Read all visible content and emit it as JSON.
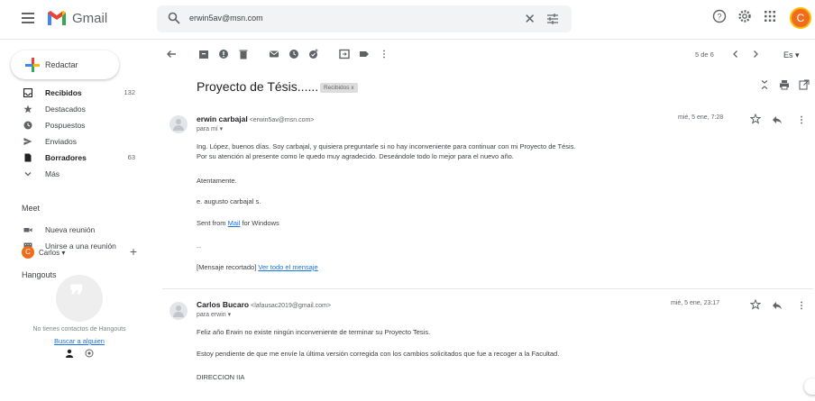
{
  "app": {
    "brand": "Gmail",
    "avatar_letter": "C",
    "colors": {
      "avatar": "#f06c1c",
      "link": "#1a73e8",
      "gmail_red": "#ea4335",
      "gmail_blue": "#4285f4",
      "gmail_green": "#34a853",
      "gmail_yellow": "#fbbc04"
    }
  },
  "search": {
    "value": "erwin5av@msn.com"
  },
  "sidebar": {
    "compose_label": "Redactar",
    "items": [
      {
        "label": "Recibidos",
        "count": "132",
        "icon": "inbox-icon"
      },
      {
        "label": "Destacados",
        "count": "",
        "icon": "star-icon"
      },
      {
        "label": "Pospuestos",
        "count": "",
        "icon": "clock-icon"
      },
      {
        "label": "Enviados",
        "count": "",
        "icon": "send-icon"
      },
      {
        "label": "Borradores",
        "count": "63",
        "icon": "draft-icon"
      },
      {
        "label": "Más",
        "count": "",
        "icon": "chevron-down-icon"
      }
    ],
    "meet_title": "Meet",
    "meet_items": [
      {
        "label": "Nueva reunión",
        "icon": "video-icon"
      },
      {
        "label": "Unirse a una reunión",
        "icon": "keyboard-icon"
      }
    ],
    "hangouts_title": "Hangouts",
    "hangouts_user": "Carlos",
    "hangouts_user_letter": "C",
    "no_contacts": "No tienes contactos de Hangouts",
    "find_someone": "Buscar a alguien"
  },
  "toolbar": {
    "pagination": "5 de 6",
    "language": "Es"
  },
  "thread": {
    "subject": "Proyecto de Tésis......",
    "label_badge": "Recibidos x",
    "messages": [
      {
        "sender": "erwin carbajal",
        "email": "<erwin5av@msn.com>",
        "to": "para mí",
        "date": "mié, 5 ene, 7:28",
        "lines": [
          "Ing. López, buenos días. Soy carbajal, y quisiera preguntarle si no hay inconveniente para continuar con mi Proyecto de Tésis.",
          "Por su atención al presente como le quedo muy agradecido. Deseándole todo lo mejor para el nuevo año.",
          "Atentamente.",
          "e. augusto carbajal s.",
          "Sent from",
          "Mail",
          "for Windows",
          "--",
          "[Mensaje recortado]",
          "Ver todo el mensaje"
        ]
      },
      {
        "sender": "Carlos Bucaro",
        "email": "<lafausac2019@gmail.com>",
        "to": "para erwin",
        "date": "mié, 5 ene, 23:17",
        "lines": [
          "Feliz año Erwin no existe ningún inconveniente de terminar su Proyecto Tesis.",
          "Estoy pendiente de que me envíe la última versión  corregida con los cambios solicitados que fue a recoger a la Facultad.",
          "DIRECCION IIA"
        ]
      }
    ]
  }
}
